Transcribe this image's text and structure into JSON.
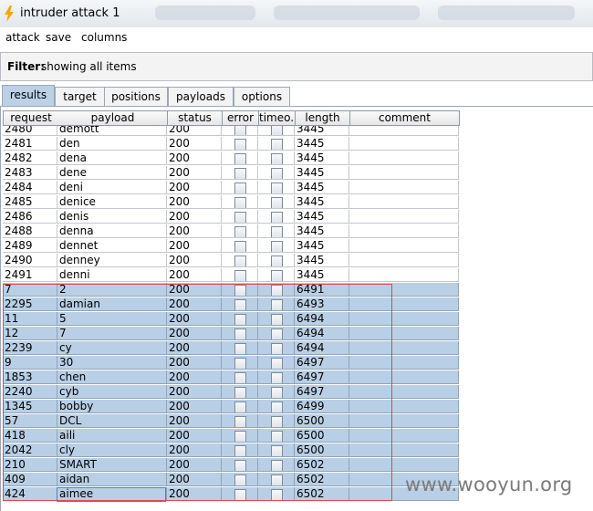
{
  "window": {
    "title": "intruder attack 1",
    "bolt_color": "#f7a600"
  },
  "menu": [
    "attack",
    "save",
    "columns"
  ],
  "filter": {
    "label": "Filter:",
    "value": "showing all items"
  },
  "tabs": [
    {
      "label": "results",
      "active": true
    },
    {
      "label": "target",
      "active": false
    },
    {
      "label": "positions",
      "active": false
    },
    {
      "label": "payloads",
      "active": false
    },
    {
      "label": "options",
      "active": false
    }
  ],
  "table": {
    "columns": [
      "request",
      "payload",
      "status",
      "error",
      "timeo...",
      "length",
      "comment"
    ],
    "rows": [
      {
        "request": "2480",
        "payload": "demott",
        "status": "200",
        "length": "3445",
        "selected": false
      },
      {
        "request": "2481",
        "payload": "den",
        "status": "200",
        "length": "3445",
        "selected": false
      },
      {
        "request": "2482",
        "payload": "dena",
        "status": "200",
        "length": "3445",
        "selected": false
      },
      {
        "request": "2483",
        "payload": "dene",
        "status": "200",
        "length": "3445",
        "selected": false
      },
      {
        "request": "2484",
        "payload": "deni",
        "status": "200",
        "length": "3445",
        "selected": false
      },
      {
        "request": "2485",
        "payload": "denice",
        "status": "200",
        "length": "3445",
        "selected": false
      },
      {
        "request": "2486",
        "payload": "denis",
        "status": "200",
        "length": "3445",
        "selected": false
      },
      {
        "request": "2488",
        "payload": "denna",
        "status": "200",
        "length": "3445",
        "selected": false
      },
      {
        "request": "2489",
        "payload": "dennet",
        "status": "200",
        "length": "3445",
        "selected": false
      },
      {
        "request": "2490",
        "payload": "denney",
        "status": "200",
        "length": "3445",
        "selected": false
      },
      {
        "request": "2491",
        "payload": "denni",
        "status": "200",
        "length": "3445",
        "selected": false
      },
      {
        "request": "7",
        "payload": "2",
        "status": "200",
        "length": "6491",
        "selected": true
      },
      {
        "request": "2295",
        "payload": "damian",
        "status": "200",
        "length": "6493",
        "selected": true
      },
      {
        "request": "11",
        "payload": "5",
        "status": "200",
        "length": "6494",
        "selected": true
      },
      {
        "request": "12",
        "payload": "7",
        "status": "200",
        "length": "6494",
        "selected": true
      },
      {
        "request": "2239",
        "payload": "cy",
        "status": "200",
        "length": "6494",
        "selected": true
      },
      {
        "request": "9",
        "payload": "30",
        "status": "200",
        "length": "6497",
        "selected": true
      },
      {
        "request": "1853",
        "payload": "chen",
        "status": "200",
        "length": "6497",
        "selected": true
      },
      {
        "request": "2240",
        "payload": "cyb",
        "status": "200",
        "length": "6497",
        "selected": true
      },
      {
        "request": "1345",
        "payload": "bobby",
        "status": "200",
        "length": "6499",
        "selected": true
      },
      {
        "request": "57",
        "payload": "DCL",
        "status": "200",
        "length": "6500",
        "selected": true
      },
      {
        "request": "418",
        "payload": "aili",
        "status": "200",
        "length": "6500",
        "selected": true
      },
      {
        "request": "2042",
        "payload": "cly",
        "status": "200",
        "length": "6500",
        "selected": true
      },
      {
        "request": "210",
        "payload": "SMART",
        "status": "200",
        "length": "6502",
        "selected": true
      },
      {
        "request": "409",
        "payload": "aidan",
        "status": "200",
        "length": "6502",
        "selected": true
      },
      {
        "request": "424",
        "payload": "aimee",
        "status": "200",
        "length": "6502",
        "selected": true
      }
    ]
  },
  "highlight_color": "#e04850",
  "watermark": "www.wooyun.org"
}
